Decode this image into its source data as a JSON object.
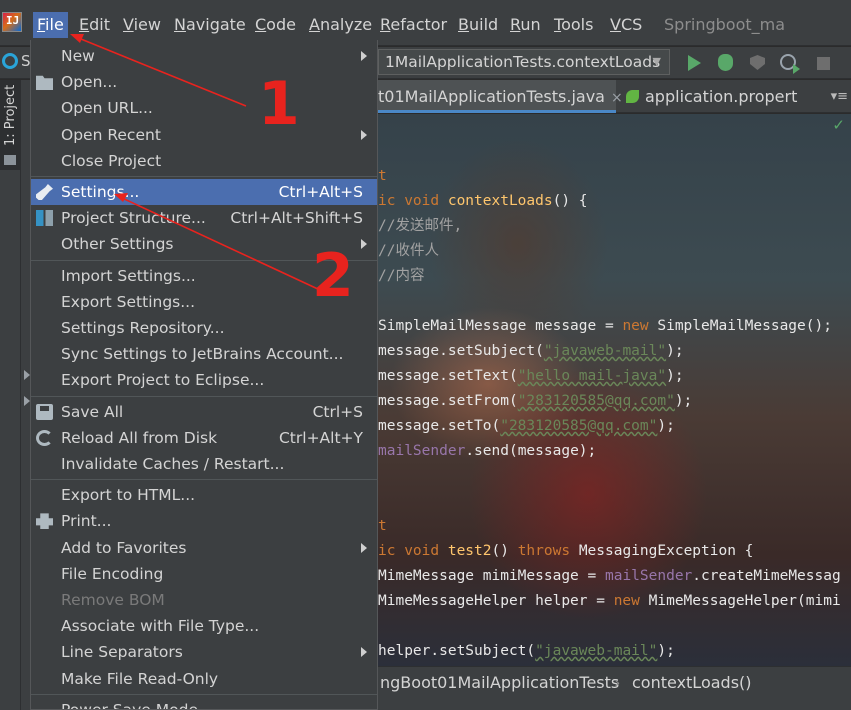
{
  "menubar": {
    "items": [
      {
        "label": "File",
        "active": true
      },
      {
        "label": "Edit"
      },
      {
        "label": "View"
      },
      {
        "label": "Navigate"
      },
      {
        "label": "Code"
      },
      {
        "label": "Analyze"
      },
      {
        "label": "Refactor"
      },
      {
        "label": "Build"
      },
      {
        "label": "Run"
      },
      {
        "label": "Tools"
      },
      {
        "label": "VCS"
      }
    ],
    "window_title": "Springboot_ma"
  },
  "toolbar": {
    "left_label": "S",
    "run_config": "1MailApplicationTests.contextLoads"
  },
  "left_strip": {
    "project_tab": "1: Project"
  },
  "tabs": [
    {
      "label": "t01MailApplicationTests.java",
      "close": "×"
    },
    {
      "label": "application.propert"
    }
  ],
  "tabs_overflow": "▾≡",
  "code_lines": [
    {
      "parts": [
        {
          "t": "t",
          "c": "kw"
        }
      ]
    },
    {
      "parts": [
        {
          "t": "ic void ",
          "c": "kw"
        },
        {
          "t": "contextLoads",
          "c": "fn"
        },
        {
          "t": "() {",
          "c": "cls"
        }
      ]
    },
    {
      "parts": [
        {
          "t": "//发送邮件,",
          "c": "cm"
        }
      ]
    },
    {
      "parts": [
        {
          "t": "//收件人",
          "c": "cm"
        }
      ]
    },
    {
      "parts": [
        {
          "t": "//内容",
          "c": "cm"
        }
      ]
    },
    {
      "parts": [
        {
          "t": "",
          "c": "cls"
        }
      ]
    },
    {
      "parts": [
        {
          "t": "SimpleMailMessage message = ",
          "c": "cls"
        },
        {
          "t": "new ",
          "c": "kw"
        },
        {
          "t": "SimpleMailMessage();",
          "c": "cls"
        }
      ]
    },
    {
      "parts": [
        {
          "t": "message.setSubject(",
          "c": "cls"
        },
        {
          "t": "\"javaweb-mail\"",
          "c": "str"
        },
        {
          "t": ");",
          "c": "cls"
        }
      ]
    },
    {
      "parts": [
        {
          "t": "message.setText(",
          "c": "cls"
        },
        {
          "t": "\"hello mail-java\"",
          "c": "str"
        },
        {
          "t": ");",
          "c": "cls"
        }
      ]
    },
    {
      "parts": [
        {
          "t": "message.setFrom(",
          "c": "cls"
        },
        {
          "t": "\"283120585@qq.com\"",
          "c": "str"
        },
        {
          "t": ");",
          "c": "cls"
        }
      ]
    },
    {
      "parts": [
        {
          "t": "message.setTo(",
          "c": "cls"
        },
        {
          "t": "\"283120585@qq.com\"",
          "c": "str"
        },
        {
          "t": ");",
          "c": "cls"
        }
      ]
    },
    {
      "parts": [
        {
          "t": "mailSender",
          "c": "fld"
        },
        {
          "t": ".send(message);",
          "c": "cls"
        }
      ]
    },
    {
      "parts": [
        {
          "t": "",
          "c": "cls"
        }
      ]
    },
    {
      "parts": [
        {
          "t": "",
          "c": "cls"
        }
      ]
    },
    {
      "parts": [
        {
          "t": "t",
          "c": "kw"
        }
      ]
    },
    {
      "parts": [
        {
          "t": "ic void ",
          "c": "kw"
        },
        {
          "t": "test2",
          "c": "fn"
        },
        {
          "t": "() ",
          "c": "cls"
        },
        {
          "t": "throws ",
          "c": "kw"
        },
        {
          "t": "MessagingException {",
          "c": "cls"
        }
      ]
    },
    {
      "parts": [
        {
          "t": "MimeMessage mimiMessage = ",
          "c": "cls"
        },
        {
          "t": "mailSender",
          "c": "fld"
        },
        {
          "t": ".createMimeMessag",
          "c": "cls"
        }
      ]
    },
    {
      "parts": [
        {
          "t": "MimeMessageHelper helper = ",
          "c": "cls"
        },
        {
          "t": "new ",
          "c": "kw"
        },
        {
          "t": "MimeMessageHelper(mimi",
          "c": "cls"
        }
      ]
    },
    {
      "parts": [
        {
          "t": "",
          "c": "cls"
        }
      ]
    },
    {
      "parts": [
        {
          "t": "helper.setSubject(",
          "c": "cls"
        },
        {
          "t": "\"javaweb-mail\"",
          "c": "str"
        },
        {
          "t": ");",
          "c": "cls"
        }
      ]
    }
  ],
  "breadcrumb": {
    "class": "ngBoot01MailApplicationTests",
    "separator": "›",
    "method": "contextLoads()"
  },
  "file_menu": {
    "items": [
      {
        "label": "New",
        "submenu": true
      },
      {
        "label": "Open...",
        "icon": "folder-icon"
      },
      {
        "label": "Open URL..."
      },
      {
        "label": "Open Recent",
        "submenu": true
      },
      {
        "label": "Close Project"
      },
      {
        "sep": true
      },
      {
        "label": "Settings...",
        "shortcut": "Ctrl+Alt+S",
        "icon": "wrench-icon",
        "highlighted": true
      },
      {
        "label": "Project Structure...",
        "shortcut": "Ctrl+Alt+Shift+S",
        "icon": "project-structure-icon"
      },
      {
        "label": "Other Settings",
        "submenu": true
      },
      {
        "sep": true
      },
      {
        "label": "Import Settings..."
      },
      {
        "label": "Export Settings..."
      },
      {
        "label": "Settings Repository..."
      },
      {
        "label": "Sync Settings to JetBrains Account..."
      },
      {
        "label": "Export Project to Eclipse..."
      },
      {
        "sep": true
      },
      {
        "label": "Save All",
        "shortcut": "Ctrl+S",
        "icon": "save-icon"
      },
      {
        "label": "Reload All from Disk",
        "shortcut": "Ctrl+Alt+Y",
        "icon": "reload-icon"
      },
      {
        "label": "Invalidate Caches / Restart..."
      },
      {
        "sep": true
      },
      {
        "label": "Export to HTML..."
      },
      {
        "label": "Print...",
        "icon": "print-icon"
      },
      {
        "label": "Add to Favorites",
        "submenu": true
      },
      {
        "label": "File Encoding"
      },
      {
        "label": "Remove BOM",
        "disabled": true
      },
      {
        "label": "Associate with File Type..."
      },
      {
        "label": "Line Separators",
        "submenu": true
      },
      {
        "label": "Make File Read-Only"
      },
      {
        "sep": true
      },
      {
        "label": "Power Save Mode"
      }
    ]
  },
  "annotations": {
    "number_1": "1",
    "number_2": "2",
    "color": "#e8231e"
  },
  "colors": {
    "highlight": "#4b6eaf",
    "menu_bg": "#3c3f41",
    "run_green": "#59a869"
  }
}
